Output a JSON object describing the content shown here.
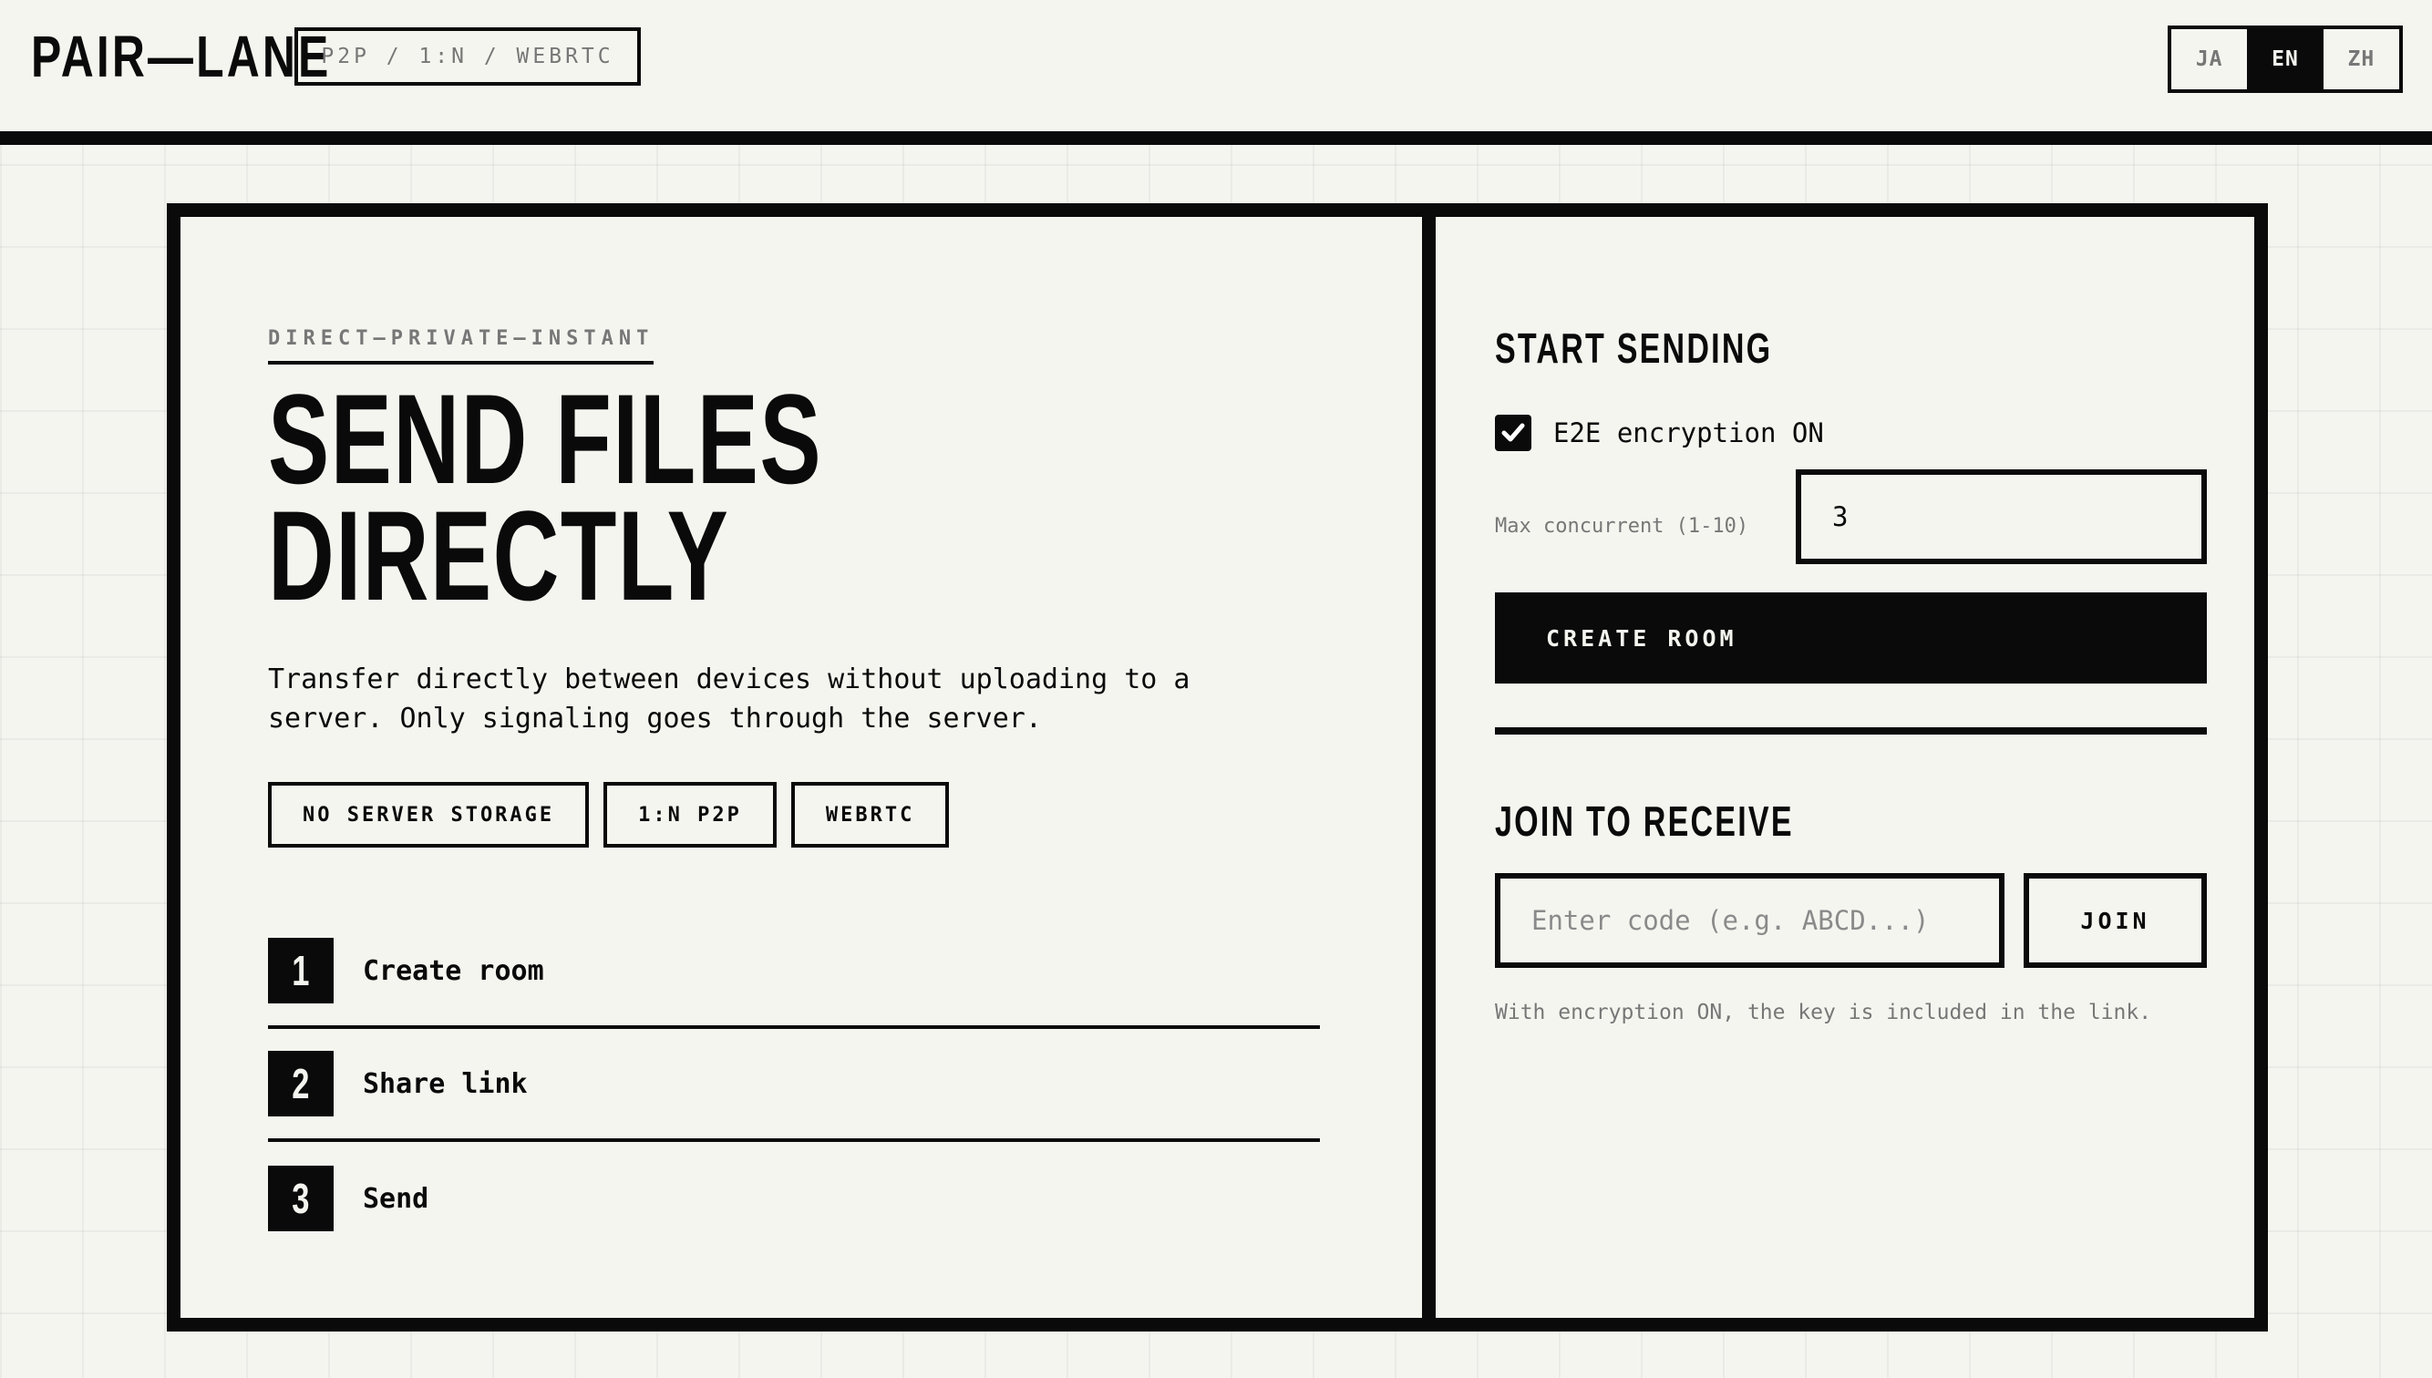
{
  "header": {
    "logo": "PAIR—LANE",
    "tagline": "P2P / 1:N / WEBRTC",
    "languages": [
      {
        "label": "JA",
        "active": false
      },
      {
        "label": "EN",
        "active": true
      },
      {
        "label": "ZH",
        "active": false
      }
    ]
  },
  "hero": {
    "eyebrow": "DIRECT—PRIVATE—INSTANT",
    "title_line1": "SEND FILES",
    "title_line2": "DIRECTLY",
    "description": "Transfer directly between devices without uploading to a server. Only signaling goes through the server.",
    "features": [
      "NO SERVER STORAGE",
      "1:N P2P",
      "WEBRTC"
    ],
    "steps": [
      {
        "num": "1",
        "label": "Create room"
      },
      {
        "num": "2",
        "label": "Share link"
      },
      {
        "num": "3",
        "label": "Send"
      }
    ]
  },
  "send": {
    "title": "START SENDING",
    "encryption_label": "E2E encryption ON",
    "encryption_checked": true,
    "max_label": "Max concurrent (1-10)",
    "max_value": "3",
    "create_button": "CREATE ROOM"
  },
  "receive": {
    "title": "JOIN TO RECEIVE",
    "code_placeholder": "Enter code (e.g. ABCD...)",
    "code_value": "",
    "join_button": "JOIN",
    "hint": "With encryption ON, the key is included in the link."
  },
  "icons": {
    "checkbox": "checkmark-icon"
  }
}
